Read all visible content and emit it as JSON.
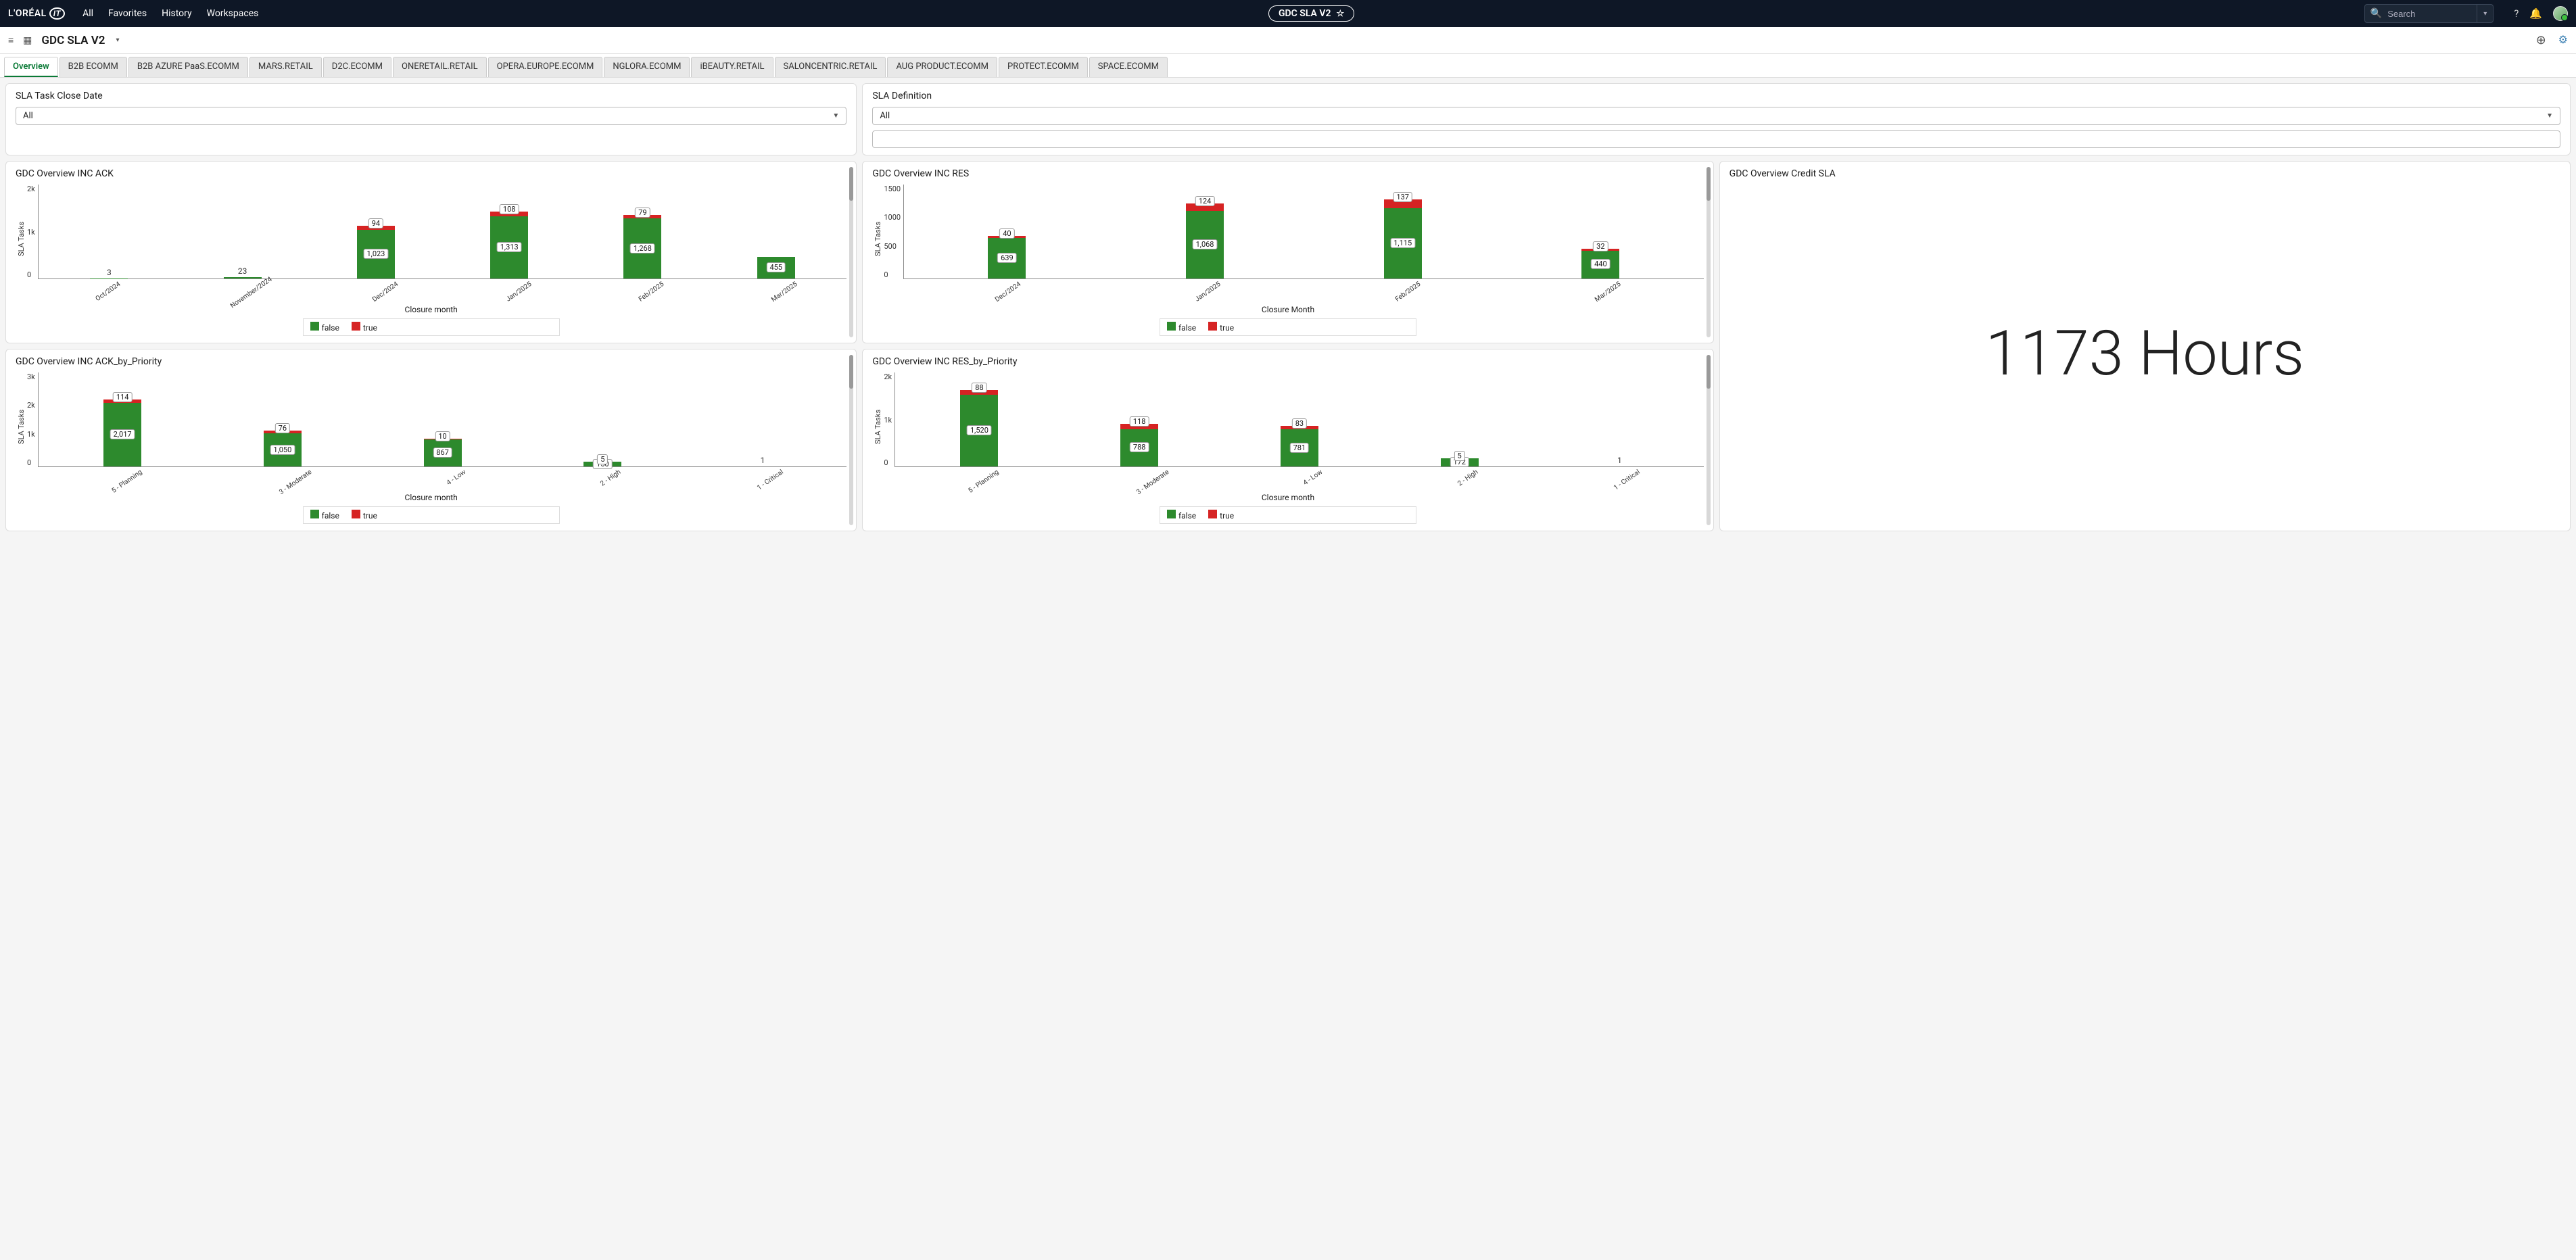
{
  "nav": {
    "logo": "L'ORÉAL",
    "logo_it": "IT",
    "items": [
      "All",
      "Favorites",
      "History",
      "Workspaces"
    ],
    "page_chip": "GDC SLA V2",
    "search_placeholder": "Search"
  },
  "subbar": {
    "page_name": "GDC SLA V2"
  },
  "tabs": [
    "Overview",
    "B2B ECOMM",
    "B2B AZURE PaaS.ECOMM",
    "MARS.RETAIL",
    "D2C.ECOMM",
    "ONERETAIL.RETAIL",
    "OPERA.EUROPE.ECOMM",
    "NGLORA.ECOMM",
    "iBEAUTY.RETAIL",
    "SALONCENTRIC.RETAIL",
    "AUG PRODUCT.ECOMM",
    "PROTECT.ECOMM",
    "SPACE.ECOMM"
  ],
  "active_tab": 0,
  "filters": {
    "close_date": {
      "title": "SLA Task Close Date",
      "value": "All"
    },
    "definition": {
      "title": "SLA Definition",
      "value": "All"
    }
  },
  "legend": {
    "false_label": "false",
    "true_label": "true"
  },
  "credit_sla": {
    "title": "GDC Overview Credit SLA",
    "value": "1173 Hours"
  },
  "chart_data": [
    {
      "id": "inc_ack",
      "title": "GDC Overview INC ACK",
      "type": "bar",
      "stacked": true,
      "ylabel": "SLA Tasks",
      "xlabel": "Closure month",
      "ylim": [
        0,
        2000
      ],
      "yticks": [
        "2k",
        "1k",
        "0"
      ],
      "categories": [
        "Oct/2024",
        "November/2024",
        "Dec/2024",
        "Jan/2025",
        "Feb/2025",
        "Mar/2025"
      ],
      "series": [
        {
          "name": "false",
          "values": [
            3,
            23,
            1023,
            1313,
            1268,
            455
          ]
        },
        {
          "name": "true",
          "values": [
            0,
            0,
            94,
            108,
            79,
            0
          ]
        }
      ]
    },
    {
      "id": "inc_res",
      "title": "GDC Overview INC RES",
      "type": "bar",
      "stacked": true,
      "ylabel": "SLA Tasks",
      "xlabel": "Closure Month",
      "ylim": [
        0,
        1500
      ],
      "yticks": [
        "1500",
        "1000",
        "500",
        "0"
      ],
      "categories": [
        "Dec/2024",
        "Jan/2025",
        "Feb/2025",
        "Mar/2025"
      ],
      "series": [
        {
          "name": "false",
          "values": [
            639,
            1068,
            1115,
            440
          ]
        },
        {
          "name": "true",
          "values": [
            40,
            124,
            137,
            32
          ]
        }
      ]
    },
    {
      "id": "inc_ack_prio",
      "title": "GDC Overview INC ACK_by_Priority",
      "type": "bar",
      "stacked": true,
      "ylabel": "SLA Tasks",
      "xlabel": "Closure month",
      "ylim": [
        0,
        3000
      ],
      "yticks": [
        "3k",
        "2k",
        "1k",
        "0"
      ],
      "categories": [
        "5 - Planning",
        "3 - Moderate",
        "4 - Low",
        "2 - High",
        "1 - Critical"
      ],
      "series": [
        {
          "name": "false",
          "values": [
            2017,
            1050,
            867,
            150,
            1
          ]
        },
        {
          "name": "true",
          "values": [
            114,
            76,
            10,
            5,
            0
          ]
        }
      ]
    },
    {
      "id": "inc_res_prio",
      "title": "GDC Overview INC RES_by_Priority",
      "type": "bar",
      "stacked": true,
      "ylabel": "SLA Tasks",
      "xlabel": "Closure month",
      "ylim": [
        0,
        2000
      ],
      "yticks": [
        "2k",
        "1k",
        "0"
      ],
      "categories": [
        "5 - Planning",
        "3 - Moderate",
        "4 - Low",
        "2 - High",
        "1 - Critical"
      ],
      "series": [
        {
          "name": "false",
          "values": [
            1520,
            788,
            781,
            172,
            1
          ]
        },
        {
          "name": "true",
          "values": [
            88,
            118,
            83,
            5,
            0
          ]
        }
      ]
    }
  ]
}
